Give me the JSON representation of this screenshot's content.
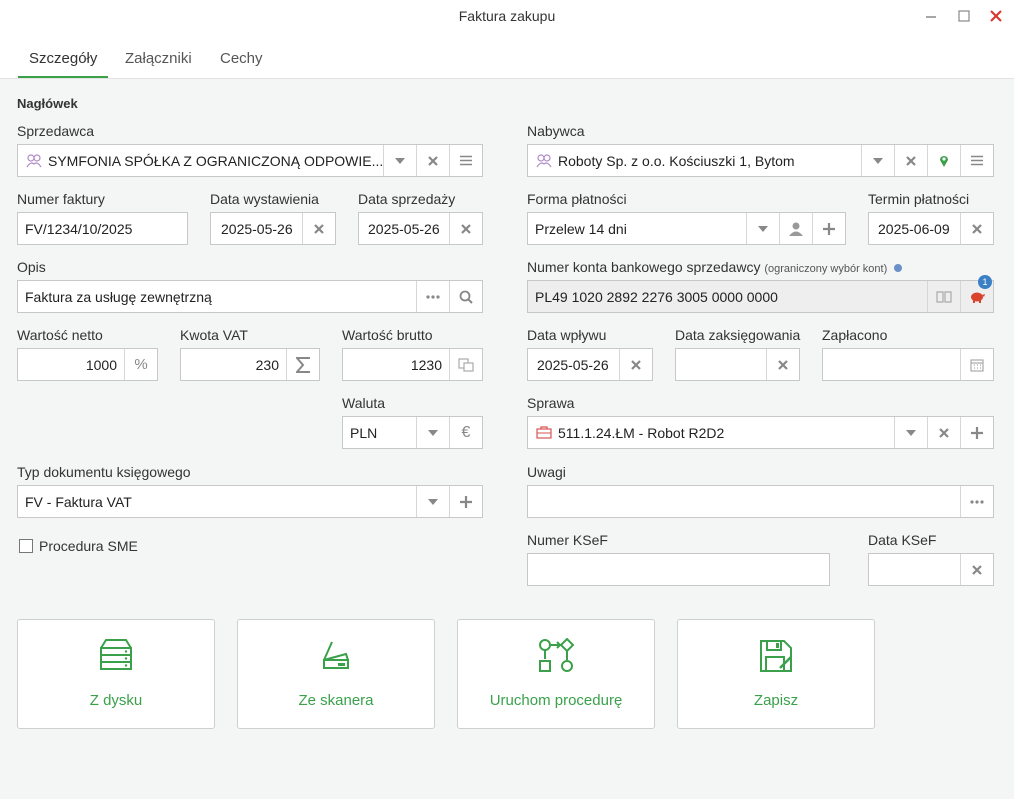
{
  "window": {
    "title": "Faktura zakupu"
  },
  "tabs": [
    {
      "label": "Szczegóły"
    },
    {
      "label": "Załączniki"
    },
    {
      "label": "Cechy"
    }
  ],
  "section": {
    "header": "Nagłówek"
  },
  "seller": {
    "label": "Sprzedawca",
    "value": "SYMFONIA SPÓŁKA Z OGRANICZONĄ ODPOWIE..."
  },
  "buyer": {
    "label": "Nabywca",
    "value": "Roboty Sp. z o.o. Kościuszki 1, Bytom"
  },
  "invoice_number": {
    "label": "Numer faktury",
    "value": "FV/1234/10/2025"
  },
  "issue_date": {
    "label": "Data wystawienia",
    "value": "2025-05-26"
  },
  "sale_date": {
    "label": "Data sprzedaży",
    "value": "2025-05-26"
  },
  "payment_form": {
    "label": "Forma płatności",
    "value": "Przelew 14 dni"
  },
  "payment_due": {
    "label": "Termin płatności",
    "value": "2025-06-09"
  },
  "description": {
    "label": "Opis",
    "value": "Faktura za usługę zewnętrzną"
  },
  "bank_account": {
    "label": "Numer konta bankowego sprzedawcy",
    "note": "(ograniczony wybór kont)",
    "value": "PL49 1020 2892 2276 3005 0000 0000",
    "badge": "1"
  },
  "net": {
    "label": "Wartość netto",
    "value": "1000"
  },
  "vat": {
    "label": "Kwota VAT",
    "value": "230"
  },
  "gross": {
    "label": "Wartość brutto",
    "value": "1230"
  },
  "receipt_date": {
    "label": "Data wpływu",
    "value": "2025-05-26"
  },
  "posting_date": {
    "label": "Data zaksięgowania",
    "value": ""
  },
  "paid": {
    "label": "Zapłacono",
    "value": ""
  },
  "currency": {
    "label": "Waluta",
    "value": "PLN"
  },
  "case": {
    "label": "Sprawa",
    "value": "511.1.24.ŁM - Robot R2D2"
  },
  "doc_type": {
    "label": "Typ dokumentu księgowego",
    "value": "FV - Faktura VAT"
  },
  "notes": {
    "label": "Uwagi",
    "value": ""
  },
  "sme": {
    "label": "Procedura SME",
    "checked": false
  },
  "ksef_number": {
    "label": "Numer KSeF",
    "value": ""
  },
  "ksef_date": {
    "label": "Data KSeF",
    "value": ""
  },
  "actions": [
    {
      "label": "Z dysku",
      "icon": "disk-stack-icon"
    },
    {
      "label": "Ze skanera",
      "icon": "scanner-icon"
    },
    {
      "label": "Uruchom procedurę",
      "icon": "flowchart-icon"
    },
    {
      "label": "Zapisz",
      "icon": "save-icon"
    }
  ],
  "colors": {
    "accent": "#3aa14a",
    "badge": "#3b7fc4",
    "icon": "#888888"
  }
}
